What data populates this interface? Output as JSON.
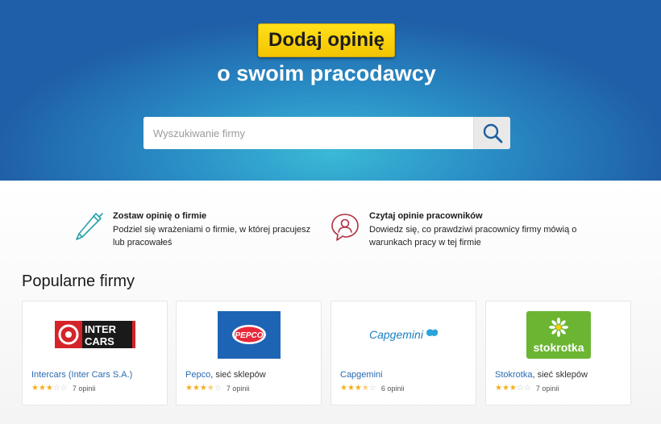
{
  "hero": {
    "cta_label": "Dodaj opinię",
    "subtitle": "o swoim pracodawcy",
    "search_placeholder": "Wyszukiwanie firmy",
    "search_value": ""
  },
  "features": [
    {
      "icon": "pen-icon",
      "title": "Zostaw opinię o firmie",
      "text_line1": "Podziel się wrażeniami o firmie, w której pracujesz",
      "text_line2": "lub pracowałeś"
    },
    {
      "icon": "user-chat-icon",
      "title": "Czytaj opinie pracowników",
      "text_line1": "Dowiedz się, co prawdziwi pracownicy firmy mówią o",
      "text_line2": "warunkach pracy w tej firmie"
    }
  ],
  "popular": {
    "title": "Popularne firmy",
    "companies": [
      {
        "name": "Intercars (Inter Cars S.A.)",
        "suffix": "",
        "rating": 3,
        "reviews": "7 opinii",
        "logo_text": "INTER CARS"
      },
      {
        "name": "Pepco",
        "suffix": ", sieć sklepów",
        "rating": 3.5,
        "reviews": "7 opinii",
        "logo_text": "PEPCO"
      },
      {
        "name": "Capgemini",
        "suffix": "",
        "rating": 3.5,
        "reviews": "6 opinii",
        "logo_text": "Capgemini"
      },
      {
        "name": "Stokrotka",
        "suffix": ", sieć sklepów",
        "rating": 3,
        "reviews": "7 opinii",
        "logo_text": "stokrotka"
      }
    ]
  },
  "colors": {
    "cta_yellow": "#f7d00b",
    "link_blue": "#2a6ab2",
    "icon_teal": "#2aa3a8",
    "icon_red": "#b3303f",
    "star_gold": "#f2b01e",
    "intercars_red": "#d5232a",
    "pepco_blue": "#1e64b5",
    "capgemini_blue": "#1a7fc0",
    "stokrotka_green": "#6bb533"
  }
}
